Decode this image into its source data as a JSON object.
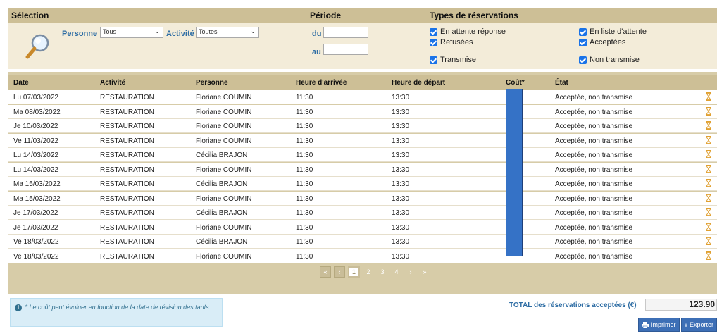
{
  "filter": {
    "headers": {
      "selection": "Sélection",
      "periode": "Période",
      "types": "Types de réservations"
    },
    "personne_label": "Personne",
    "personne_value": "Tous",
    "activite_label": "Activité",
    "activite_value": "Toutes",
    "du_label": "du",
    "au_label": "au",
    "du_value": "",
    "au_value": "",
    "checkboxes": [
      {
        "label": "En attente réponse",
        "checked": true
      },
      {
        "label": "En liste d'attente",
        "checked": true
      },
      {
        "label": "Refusées",
        "checked": true
      },
      {
        "label": "Acceptées",
        "checked": true
      },
      {
        "label": "Transmise",
        "checked": true
      },
      {
        "label": "Non transmise",
        "checked": true
      }
    ]
  },
  "table": {
    "columns": [
      "Date",
      "Activité",
      "Personne",
      "Heure d'arrivée",
      "Heure de départ",
      "Coût*",
      "État"
    ],
    "rows": [
      {
        "date": "Lu 07/03/2022",
        "activite": "RESTAURATION",
        "personne": "Floriane COUMIN",
        "arrivee": "11:30",
        "depart": "13:30",
        "etat": "Acceptée, non transmise"
      },
      {
        "date": "Ma 08/03/2022",
        "activite": "RESTAURATION",
        "personne": "Floriane COUMIN",
        "arrivee": "11:30",
        "depart": "13:30",
        "etat": "Acceptée, non transmise"
      },
      {
        "date": "Je 10/03/2022",
        "activite": "RESTAURATION",
        "personne": "Floriane COUMIN",
        "arrivee": "11:30",
        "depart": "13:30",
        "etat": "Acceptée, non transmise"
      },
      {
        "date": "Ve 11/03/2022",
        "activite": "RESTAURATION",
        "personne": "Floriane COUMIN",
        "arrivee": "11:30",
        "depart": "13:30",
        "etat": "Acceptée, non transmise"
      },
      {
        "date": "Lu 14/03/2022",
        "activite": "RESTAURATION",
        "personne": "Cécilia BRAJON",
        "arrivee": "11:30",
        "depart": "13:30",
        "etat": "Acceptée, non transmise"
      },
      {
        "date": "Lu 14/03/2022",
        "activite": "RESTAURATION",
        "personne": "Floriane COUMIN",
        "arrivee": "11:30",
        "depart": "13:30",
        "etat": "Acceptée, non transmise"
      },
      {
        "date": "Ma 15/03/2022",
        "activite": "RESTAURATION",
        "personne": "Cécilia BRAJON",
        "arrivee": "11:30",
        "depart": "13:30",
        "etat": "Acceptée, non transmise"
      },
      {
        "date": "Ma 15/03/2022",
        "activite": "RESTAURATION",
        "personne": "Floriane COUMIN",
        "arrivee": "11:30",
        "depart": "13:30",
        "etat": "Acceptée, non transmise"
      },
      {
        "date": "Je 17/03/2022",
        "activite": "RESTAURATION",
        "personne": "Cécilia BRAJON",
        "arrivee": "11:30",
        "depart": "13:30",
        "etat": "Acceptée, non transmise"
      },
      {
        "date": "Je 17/03/2022",
        "activite": "RESTAURATION",
        "personne": "Floriane COUMIN",
        "arrivee": "11:30",
        "depart": "13:30",
        "etat": "Acceptée, non transmise"
      },
      {
        "date": "Ve 18/03/2022",
        "activite": "RESTAURATION",
        "personne": "Cécilia BRAJON",
        "arrivee": "11:30",
        "depart": "13:30",
        "etat": "Acceptée, non transmise"
      },
      {
        "date": "Ve 18/03/2022",
        "activite": "RESTAURATION",
        "personne": "Floriane COUMIN",
        "arrivee": "11:30",
        "depart": "13:30",
        "etat": "Acceptée, non transmise"
      }
    ],
    "status_icon": "hourglass-icon"
  },
  "pagination": {
    "first": "«",
    "prev": "‹",
    "pages": [
      "1",
      "2",
      "3",
      "4"
    ],
    "current": "1",
    "next": "›",
    "last": "»"
  },
  "footer": {
    "note": "* Le coût peut évoluer en fonction de la date de révision des tarifs.",
    "total_label": "TOTAL des réservations acceptées (€)",
    "total_value": "123.90",
    "print_label": "Imprimer",
    "export_label": "Exporter"
  },
  "colors": {
    "header_bg": "#cdbf96",
    "panel_bg": "#f3ecd9",
    "table_bg": "#d7cca8",
    "accent_blue": "#2e6da4",
    "checkbox_blue": "#1a73e8",
    "button_blue": "#3d6fb6",
    "hourglass": "#e0a030",
    "info_bg": "#d9edf7"
  }
}
